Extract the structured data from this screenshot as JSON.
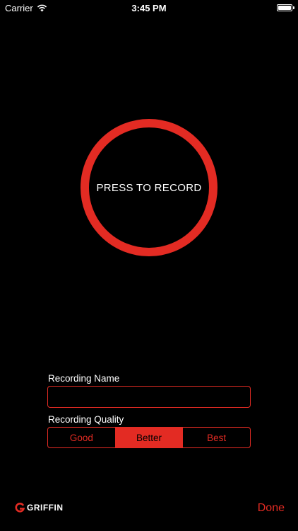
{
  "status_bar": {
    "carrier": "Carrier",
    "time": "3:45 PM",
    "wifi_icon": "wifi-icon",
    "battery_icon": "battery-icon",
    "battery_level": 1.0
  },
  "recorder": {
    "button_label": "PRESS TO RECORD"
  },
  "form": {
    "name_label": "Recording Name",
    "name_value": "",
    "quality_label": "Recording Quality",
    "quality_options": [
      "Good",
      "Better",
      "Best"
    ],
    "quality_selected": "Better"
  },
  "footer": {
    "logo_text": "GRIFFIN",
    "logo_icon": "griffin-logo-icon",
    "done_label": "Done"
  },
  "colors": {
    "accent": "#e32b23",
    "background": "#000000",
    "text": "#ffffff"
  }
}
